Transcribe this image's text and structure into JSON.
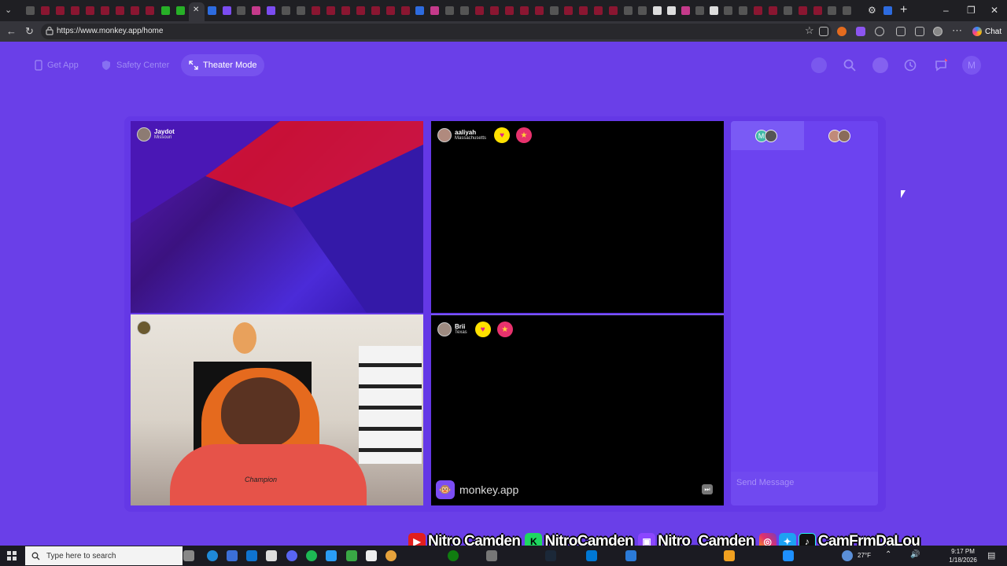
{
  "browser": {
    "url": "https://www.monkey.app/home",
    "chat_label": "Chat"
  },
  "header": {
    "get_app": "Get App",
    "safety_center": "Safety Center",
    "theater_mode": "Theater Mode",
    "avatar_initial": "M"
  },
  "tiles": [
    {
      "name": "Jaydot",
      "location": "Missouri"
    },
    {
      "name": "aaliyah",
      "location": "Massachusetts"
    },
    {
      "name": "Brii",
      "location": "Texas"
    }
  ],
  "chat": {
    "tab_initial": "M",
    "placeholder": "Send Message"
  },
  "brand": {
    "logo": "🐵",
    "text": "monkey.app"
  },
  "overlay": {
    "youtube": "Nitro Camden",
    "kick": "NitroCamden",
    "twitch": "Nitro_Camden",
    "social": "CamFrmDaLou"
  },
  "webcam": {
    "shirt_text": "Champion"
  },
  "taskbar": {
    "search_placeholder": "Type here to search",
    "temperature": "27°F",
    "time": "9:17 PM",
    "date": "1/18/2026"
  },
  "colors": {
    "page_bg": "#6a3fe8",
    "tile_bg": "#000000",
    "chat_bg": "#6c43f0"
  }
}
